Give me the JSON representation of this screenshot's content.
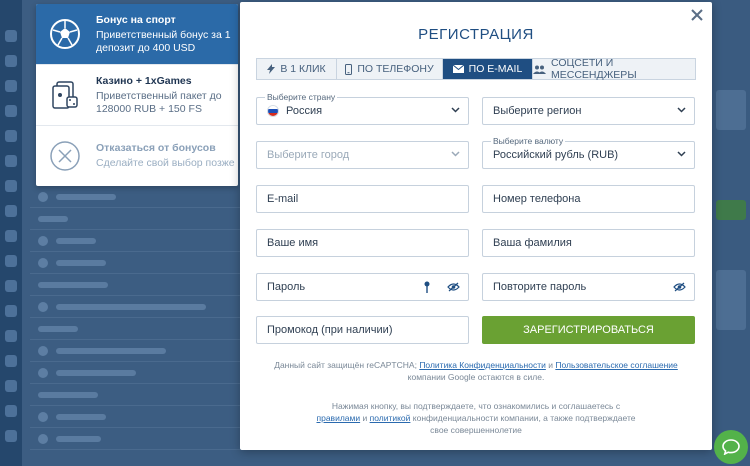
{
  "bonus_panel": {
    "items": [
      {
        "title": "Бонус на спорт",
        "text": "Приветственный бонус за 1 депозит до 400 USD"
      },
      {
        "title": "Казино + 1xGames",
        "text": "Приветственный пакет до 128000 RUB + 150 FS"
      },
      {
        "title": "Отказаться от бонусов",
        "text": "Сделайте свой выбор позже"
      }
    ]
  },
  "modal": {
    "title": "РЕГИСТРАЦИЯ",
    "tabs": [
      {
        "label": "В 1 КЛИК",
        "icon": "lightning-icon"
      },
      {
        "label": "ПО ТЕЛЕФОНУ",
        "icon": "phone-icon"
      },
      {
        "label": "ПО E-MAIL",
        "icon": "envelope-icon"
      },
      {
        "label": "СОЦСЕТИ И МЕССЕНДЖЕРЫ",
        "icon": "users-icon"
      }
    ],
    "active_tab": "ПО E-MAIL",
    "fields": {
      "country_label": "Выберите страну",
      "country_value": "Россия",
      "region_placeholder": "Выберите регион",
      "city_placeholder": "Выберите город",
      "currency_label": "Выберите валюту",
      "currency_value": "Российский рубль (RUB)",
      "email_placeholder": "E-mail",
      "phone_placeholder": "Номер телефона",
      "name_placeholder": "Ваше имя",
      "surname_placeholder": "Ваша фамилия",
      "password_placeholder": "Пароль",
      "password_repeat_placeholder": "Повторите пароль",
      "promo_placeholder": "Промокод (при наличии)"
    },
    "register_label": "ЗАРЕГИСТРИРОВАТЬСЯ",
    "recaptcha": {
      "pre": "Данный сайт защищён reCAPTCHA;",
      "link1": "Политика Конфиденциальности",
      "and": "и",
      "link2": "Пользовательское соглашение",
      "post": "компании Google остаются в силе."
    },
    "consent": {
      "pre": "Нажимая кнопку, вы подтверждаете, что ознакомились и соглашаетесь с",
      "link1": "правилами",
      "and": "и",
      "link2": "политикой",
      "post": "конфиденциальности компании, а также подтверждаете свое совершеннолетие"
    }
  },
  "colors": {
    "accent": "#1f4e82",
    "active_bonus": "#2b6aa8",
    "register_button": "#6aa133",
    "chat_button": "#53b24a"
  }
}
